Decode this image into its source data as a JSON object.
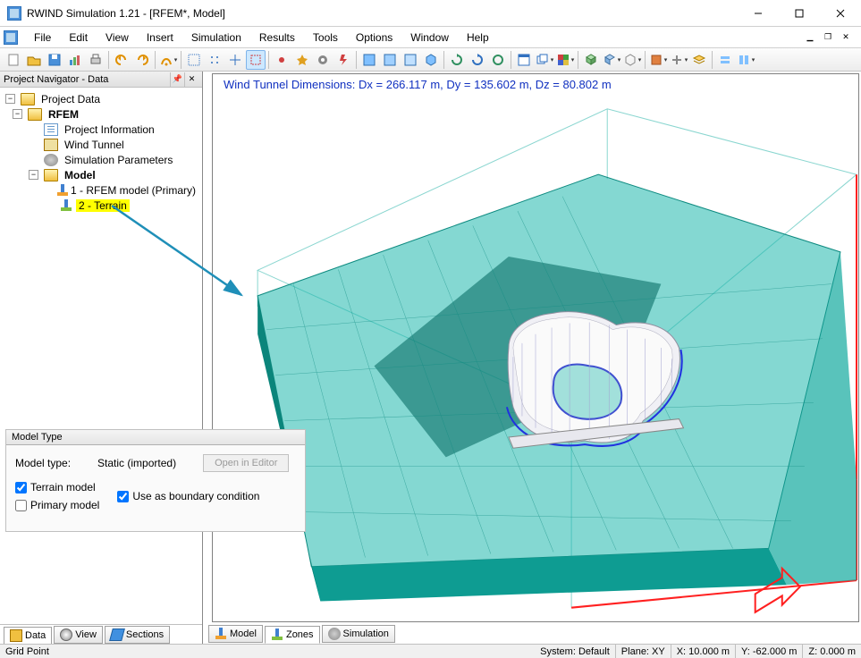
{
  "title": "RWIND Simulation 1.21 - [RFEM*, Model]",
  "menu": {
    "items": [
      "File",
      "Edit",
      "View",
      "Insert",
      "Simulation",
      "Results",
      "Tools",
      "Options",
      "Window",
      "Help"
    ]
  },
  "navigator": {
    "title": "Project Navigator - Data",
    "root": "Project Data",
    "rfem": "RFEM",
    "items": {
      "project_info": "Project Information",
      "wind_tunnel": "Wind Tunnel",
      "sim_params": "Simulation Parameters",
      "model": "Model",
      "model1": "1 - RFEM model (Primary)",
      "model2": "2 - Terrain"
    }
  },
  "model_type_panel": {
    "title": "Model Type",
    "label": "Model type:",
    "value": "Static (imported)",
    "open_button": "Open in Editor",
    "terrain_check": "Terrain model",
    "boundary_check": "Use as boundary condition",
    "primary_check": "Primary model"
  },
  "left_tabs": {
    "data": "Data",
    "view": "View",
    "sections": "Sections"
  },
  "right_tabs": {
    "model": "Model",
    "zones": "Zones",
    "simulation": "Simulation"
  },
  "viewport": {
    "dimensions": "Wind Tunnel Dimensions: Dx = 266.117 m, Dy = 135.602 m, Dz = 80.802 m"
  },
  "status": {
    "left": "Grid Point",
    "system": "System: Default",
    "plane": "Plane: XY",
    "x": "X:  10.000 m",
    "y": "Y:  -62.000 m",
    "z": "Z:  0.000 m"
  },
  "toolbar_icons": [
    "new-icon",
    "open-icon",
    "save-icon",
    "graph-icon",
    "print-icon",
    "undo-icon",
    "redo-icon",
    "run-icon",
    "grid1-icon",
    "grid2-icon",
    "grid3-icon",
    "select-icon",
    "node-icon",
    "line-icon",
    "surface-icon",
    "solid-icon",
    "view1-icon",
    "view2-icon",
    "view3-icon",
    "view4-icon",
    "refresh1-icon",
    "refresh2-icon",
    "refresh3-icon",
    "window-icon",
    "split-icon",
    "color-icon",
    "cube1-icon",
    "cube2-icon",
    "cube3-icon",
    "sep-icon",
    "tool1-icon",
    "tool2-icon",
    "layer1-icon",
    "layer2-icon",
    "layer3-icon"
  ]
}
